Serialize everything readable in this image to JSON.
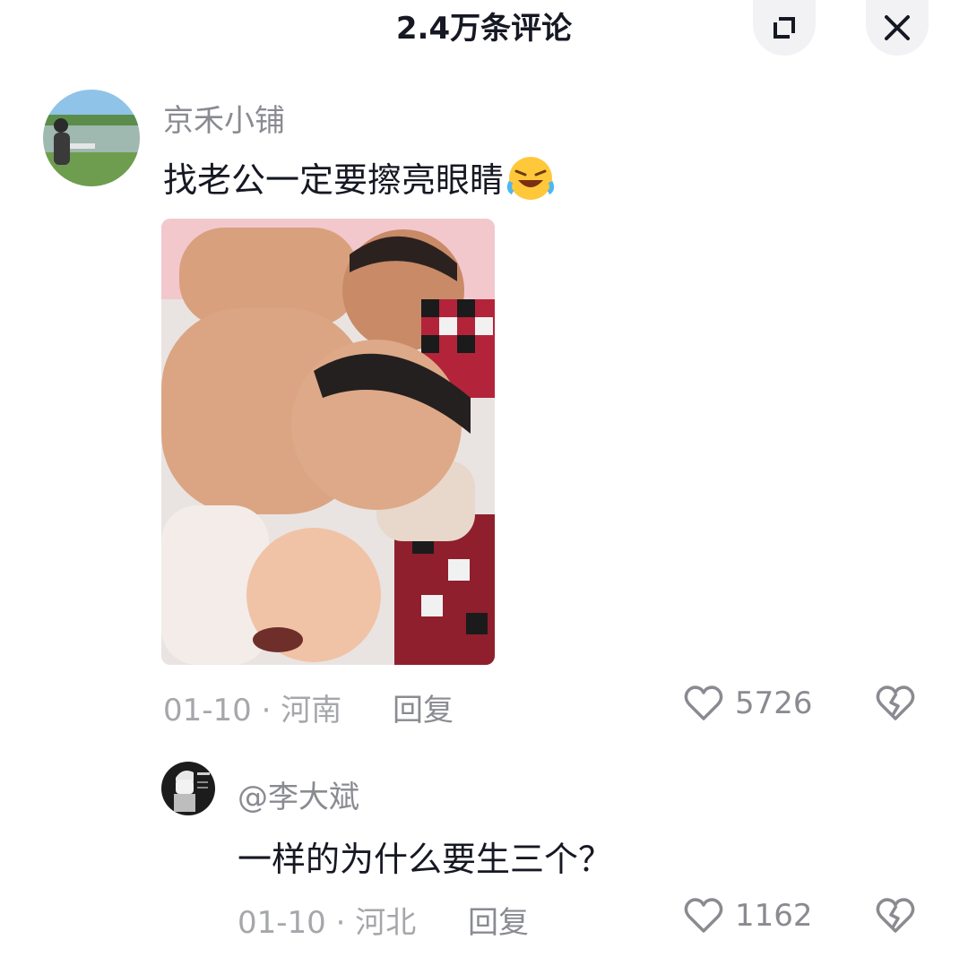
{
  "header": {
    "title": "2.4万条评论"
  },
  "comments": [
    {
      "username": "京禾小铺",
      "text": "找老公一定要擦亮眼睛",
      "emoji": "🤣",
      "date": "01-10 · 河南",
      "reply_label": "回复",
      "likes": "5726",
      "avatar_icon": "person-by-lake-avatar",
      "image_icon": "sleeping-family-photo"
    },
    {
      "username": "@李大斌",
      "text": "一样的为什么要生三个？",
      "date": "01-10 · 河北",
      "reply_label": "回复",
      "likes": "1162",
      "avatar_icon": "cartoon-character-avatar"
    }
  ],
  "colors": {
    "text": "#161823",
    "muted": "#8a8b91",
    "accent": "#fe2c55"
  }
}
